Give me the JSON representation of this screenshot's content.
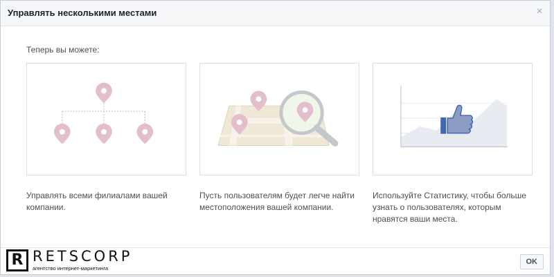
{
  "dialog": {
    "title": "Управлять несколькими местами",
    "close_icon": "×"
  },
  "intro": "Теперь вы можете:",
  "cards": [
    {
      "icon": "hierarchy-pins-illustration",
      "description": "Управлять всеми филиалами вашей компании."
    },
    {
      "icon": "map-magnifier-illustration",
      "description": "Пусть пользователям будет легче найти местоположения вашей компании."
    },
    {
      "icon": "insights-like-illustration",
      "description": "Используйте Статистику, чтобы больше узнать о пользователях, которым нравятся ваши места."
    }
  ],
  "footer": {
    "ok_label": "OK"
  },
  "watermark": {
    "letter": "R",
    "name": "RETSCORP",
    "tagline": "агентство интернет-маркетинга"
  },
  "colors": {
    "pin": "#e3bfcd",
    "line": "#c4c7cc",
    "accent": "#4267b2"
  }
}
